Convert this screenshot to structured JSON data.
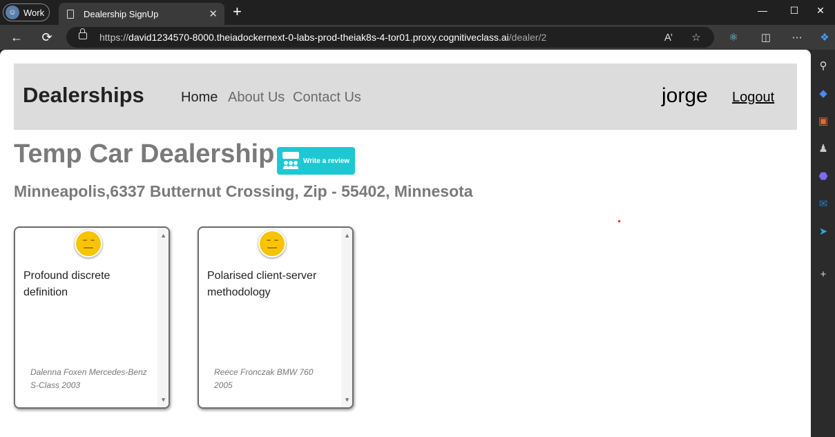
{
  "browser": {
    "profile_label": "Work",
    "tab_title": "Dealership SignUp",
    "url_prefix": "https://",
    "url_host": "david1234570-8000.theiadockernext-0-labs-prod-theiak8s-4-tor01.proxy.cognitiveclass.ai",
    "url_path": "/dealer/2"
  },
  "navbar": {
    "brand": "Dealerships",
    "links": [
      "Home",
      "About Us",
      "Contact Us"
    ],
    "username": "jorge",
    "logout": "Logout"
  },
  "dealer": {
    "name": "Temp Car Dealership",
    "review_button": "Write a review",
    "address": "Minneapolis,6337 Butternut Crossing, Zip - 55402, Minnesota"
  },
  "reviews": [
    {
      "sentiment": "neutral",
      "text": "Profound discrete definition",
      "reviewer": "Dalenna Foxen Mercedes-Benz S-Class 2003"
    },
    {
      "sentiment": "neutral",
      "text": "Polarised client-server methodology",
      "reviewer": "Reece Fronczak BMW 760 2005"
    }
  ]
}
